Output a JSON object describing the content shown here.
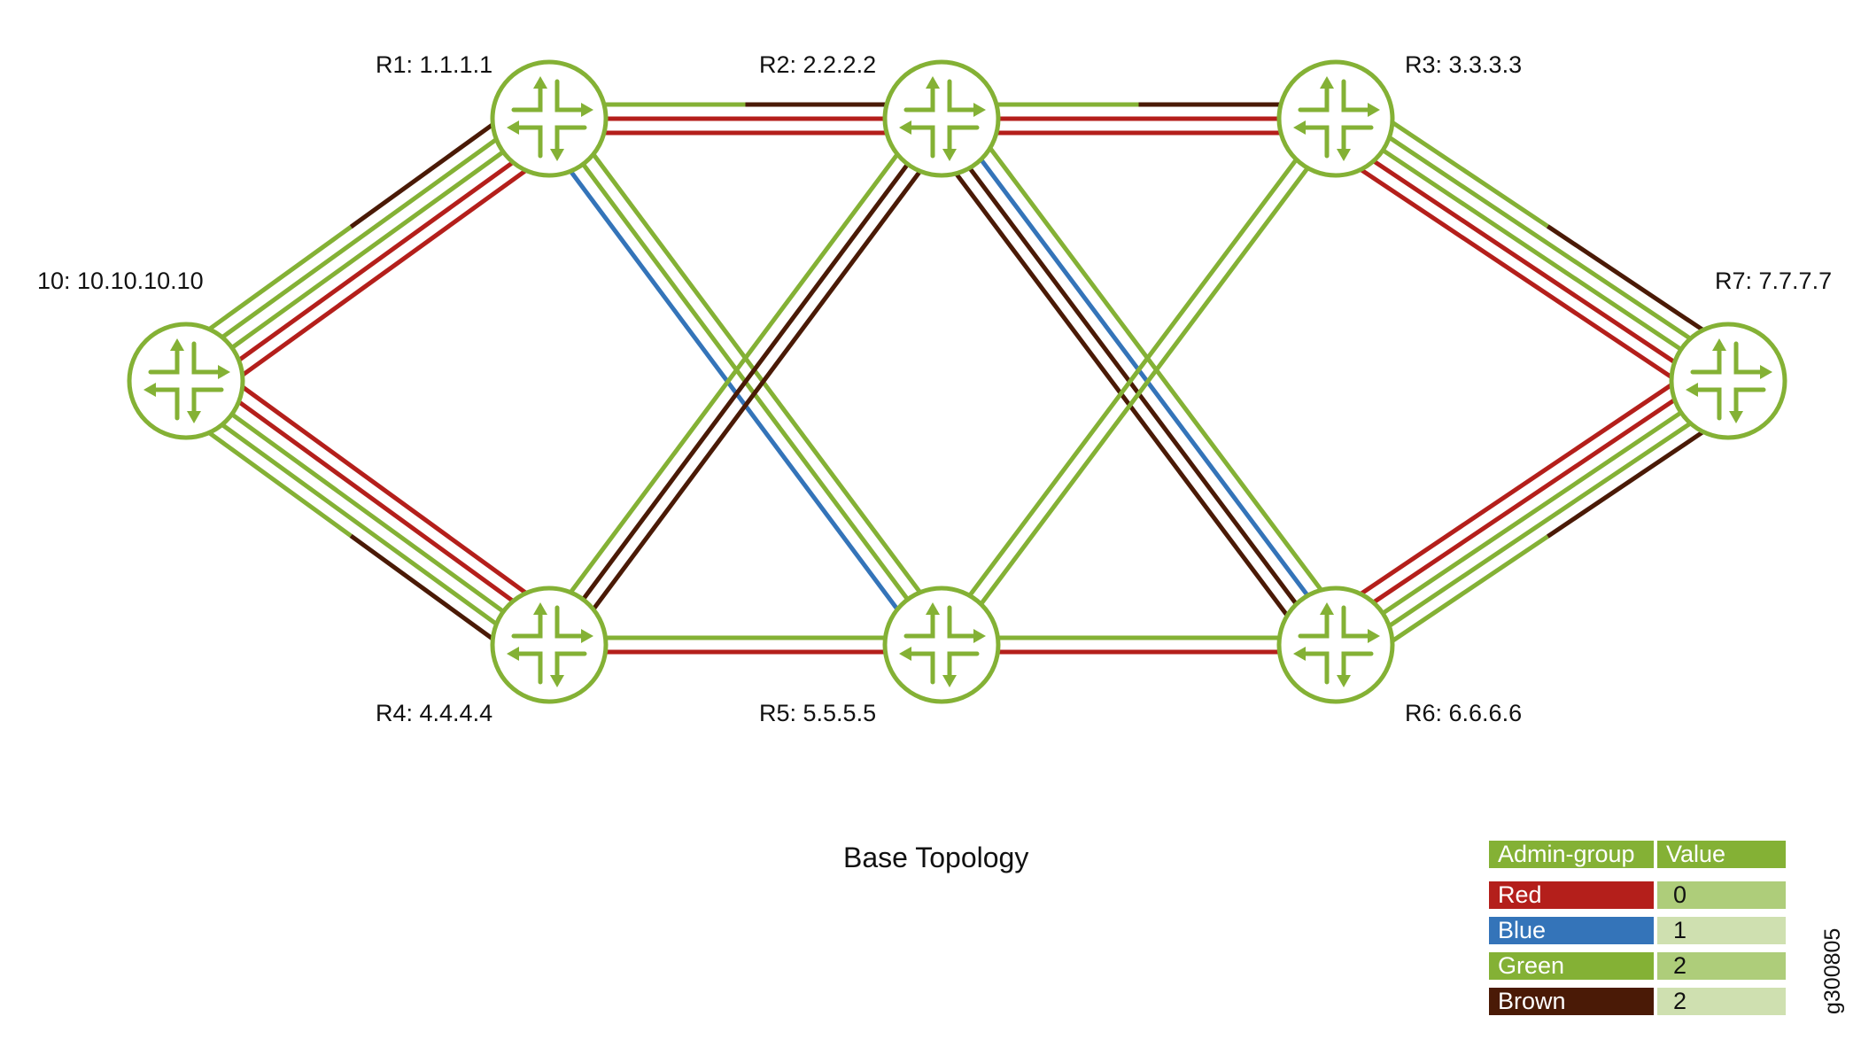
{
  "title": "Base Topology",
  "figure_id": "g300805",
  "colors": {
    "red": "#b41f1b",
    "blue": "#3474b9",
    "green": "#84b135",
    "brown": "#4a1a06",
    "router": "#84b135",
    "value_light": "#cfe0b0",
    "value_mid": "#aecd7a"
  },
  "nodes": [
    {
      "id": "R10",
      "label": "10: 10.10.10.10"
    },
    {
      "id": "R1",
      "label": "R1: 1.1.1.1"
    },
    {
      "id": "R2",
      "label": "R2: 2.2.2.2"
    },
    {
      "id": "R3",
      "label": "R3: 3.3.3.3"
    },
    {
      "id": "R7",
      "label": "R7: 7.7.7.7"
    },
    {
      "id": "R4",
      "label": "R4: 4.4.4.4"
    },
    {
      "id": "R5",
      "label": "R5: 5.5.5.5"
    },
    {
      "id": "R6",
      "label": "R6: 6.6.6.6"
    }
  ],
  "links": [
    {
      "from": "R10",
      "to": "R1",
      "strands": [
        "red",
        "red",
        "green",
        "green",
        {
          "from": "green",
          "to": "brown",
          "at": 0.5
        }
      ]
    },
    {
      "from": "R10",
      "to": "R4",
      "strands": [
        {
          "from": "green",
          "to": "brown",
          "at": 0.5
        },
        "green",
        "green",
        "red",
        "red"
      ]
    },
    {
      "from": "R1",
      "to": "R2",
      "strands": [
        "red",
        "red",
        {
          "from": "green",
          "to": "brown",
          "at": 0.5
        }
      ]
    },
    {
      "from": "R2",
      "to": "R3",
      "strands": [
        "red",
        "red",
        {
          "from": "green",
          "to": "brown",
          "at": 0.5
        }
      ]
    },
    {
      "from": "R3",
      "to": "R7",
      "strands": [
        "red",
        "red",
        "green",
        "green",
        {
          "from": "green",
          "to": "brown",
          "at": 0.5
        }
      ]
    },
    {
      "from": "R6",
      "to": "R7",
      "strands": [
        {
          "from": "green",
          "to": "brown",
          "at": 0.5
        },
        "green",
        "green",
        "red",
        "red"
      ]
    },
    {
      "from": "R4",
      "to": "R5",
      "strands": [
        "red",
        "green"
      ]
    },
    {
      "from": "R5",
      "to": "R6",
      "strands": [
        "red",
        "green"
      ]
    },
    {
      "from": "R1",
      "to": "R5",
      "strands": [
        "blue",
        "green",
        "green"
      ]
    },
    {
      "from": "R2",
      "to": "R4",
      "strands": [
        "brown",
        "brown",
        "green"
      ]
    },
    {
      "from": "R2",
      "to": "R6",
      "strands": [
        "brown",
        "brown",
        "blue",
        "green"
      ]
    },
    {
      "from": "R3",
      "to": "R5",
      "strands": [
        "green",
        "green"
      ]
    }
  ],
  "legend": {
    "header": {
      "name": "Admin-group",
      "value": "Value"
    },
    "rows": [
      {
        "name": "Red",
        "value": "0",
        "color": "#b41f1b",
        "value_bg": "#aecd7a"
      },
      {
        "name": "Blue",
        "value": "1",
        "color": "#3474b9",
        "value_bg": "#cfe0b0"
      },
      {
        "name": "Green",
        "value": "2",
        "color": "#84b135",
        "value_bg": "#aecd7a"
      },
      {
        "name": "Brown",
        "value": "2",
        "color": "#4a1a06",
        "value_bg": "#cfe0b0"
      }
    ]
  }
}
